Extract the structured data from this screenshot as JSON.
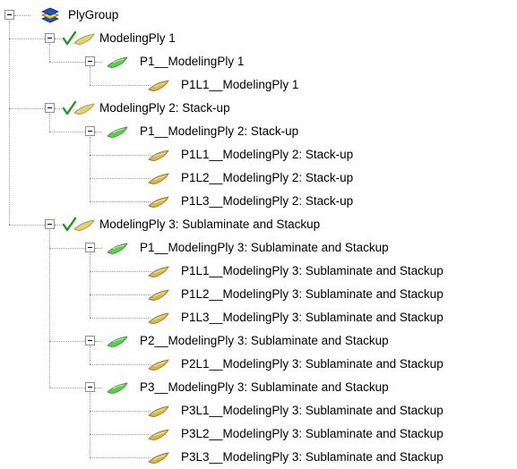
{
  "tree": {
    "label": "PlyGroup",
    "icon": "layers-stack-icon",
    "expanded": true,
    "children": [
      {
        "label": "ModelingPly 1",
        "icon": "modeling-ply-check-icon",
        "expanded": true,
        "children": [
          {
            "label": "P1__ModelingPly 1",
            "icon": "production-ply-icon",
            "expanded": true,
            "children": [
              {
                "label": "P1L1__ModelingPly 1",
                "icon": "analysis-ply-icon"
              }
            ]
          }
        ]
      },
      {
        "label": "ModelingPly 2: Stack-up",
        "icon": "modeling-ply-check-icon",
        "expanded": true,
        "children": [
          {
            "label": "P1__ModelingPly 2: Stack-up",
            "icon": "production-ply-icon",
            "expanded": true,
            "children": [
              {
                "label": "P1L1__ModelingPly 2: Stack-up",
                "icon": "analysis-ply-icon"
              },
              {
                "label": "P1L2__ModelingPly 2: Stack-up",
                "icon": "analysis-ply-icon"
              },
              {
                "label": "P1L3__ModelingPly 2: Stack-up",
                "icon": "analysis-ply-icon"
              }
            ]
          }
        ]
      },
      {
        "label": "ModelingPly 3: Sublaminate and Stackup",
        "icon": "modeling-ply-check-icon",
        "expanded": true,
        "children": [
          {
            "label": "P1__ModelingPly 3: Sublaminate and Stackup",
            "icon": "production-ply-icon",
            "expanded": true,
            "children": [
              {
                "label": "P1L1__ModelingPly 3: Sublaminate and Stackup",
                "icon": "analysis-ply-icon"
              },
              {
                "label": "P1L2__ModelingPly 3: Sublaminate and Stackup",
                "icon": "analysis-ply-icon"
              },
              {
                "label": "P1L3__ModelingPly 3: Sublaminate and Stackup",
                "icon": "analysis-ply-icon"
              }
            ]
          },
          {
            "label": "P2__ModelingPly 3: Sublaminate and Stackup",
            "icon": "production-ply-icon",
            "expanded": true,
            "children": [
              {
                "label": "P2L1__ModelingPly 3: Sublaminate and Stackup",
                "icon": "analysis-ply-icon"
              }
            ]
          },
          {
            "label": "P3__ModelingPly 3: Sublaminate and Stackup",
            "icon": "production-ply-icon",
            "expanded": true,
            "children": [
              {
                "label": "P3L1__ModelingPly 3: Sublaminate and Stackup",
                "icon": "analysis-ply-icon"
              },
              {
                "label": "P3L2__ModelingPly 3: Sublaminate and Stackup",
                "icon": "analysis-ply-icon"
              },
              {
                "label": "P3L3__ModelingPly 3: Sublaminate and Stackup",
                "icon": "analysis-ply-icon"
              }
            ]
          }
        ]
      }
    ]
  },
  "colors": {
    "guide": "#9a9a9a",
    "modeling_ply": "#e8d070",
    "production_ply": "#5ccf4a",
    "analysis_ply": "#d9b84a",
    "check": "#1f9a1f",
    "stack_blue": "#1c4fd0",
    "stack_yellow": "#f2d21c"
  }
}
